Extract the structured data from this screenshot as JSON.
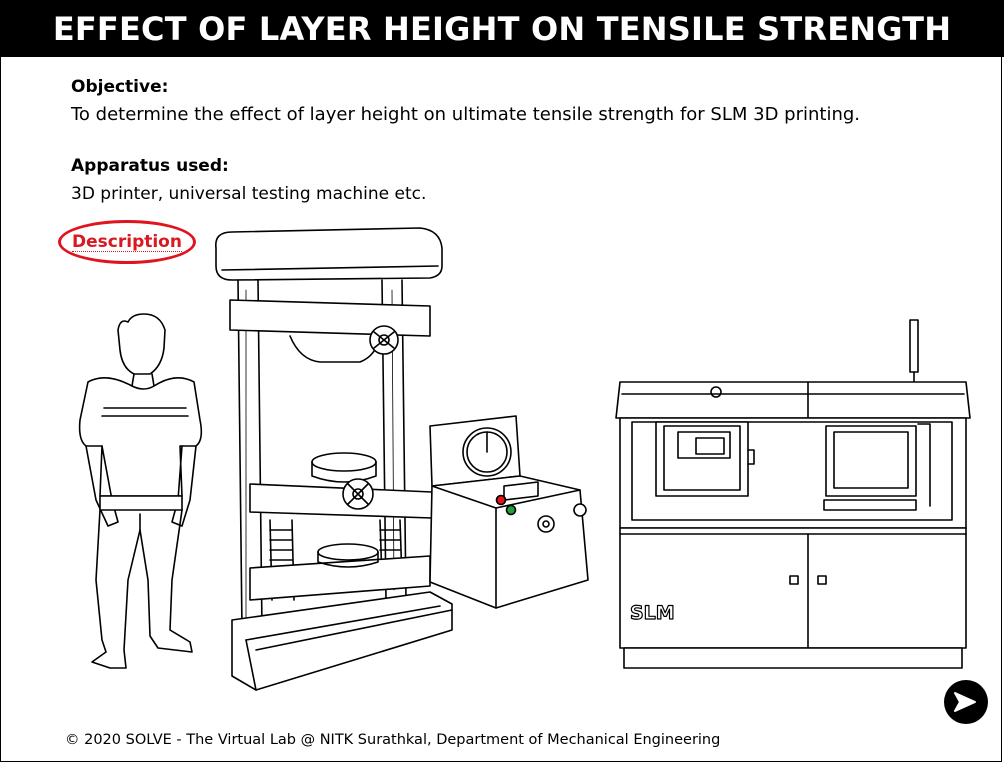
{
  "header": {
    "title": "EFFECT OF LAYER HEIGHT ON TENSILE STRENGTH"
  },
  "objective": {
    "label": "Objective:",
    "text": "To determine the effect of layer height on ultimate tensile strength for SLM 3D printing."
  },
  "apparatus": {
    "label": "Apparatus used:",
    "text": "3D printer, universal testing machine etc."
  },
  "description_button": {
    "label": "Description"
  },
  "illustration": {
    "printer_label": "SLM"
  },
  "footer": {
    "text": "© 2020 SOLVE - The Virtual Lab @ NITK Surathkal, Department of Mechanical Engineering"
  },
  "colors": {
    "accent_red": "#e0141e",
    "title_bg": "#000000",
    "indicator_red": "#e3141b",
    "indicator_green": "#1fa03a"
  },
  "icons": {
    "next": "next-arrow-icon"
  }
}
